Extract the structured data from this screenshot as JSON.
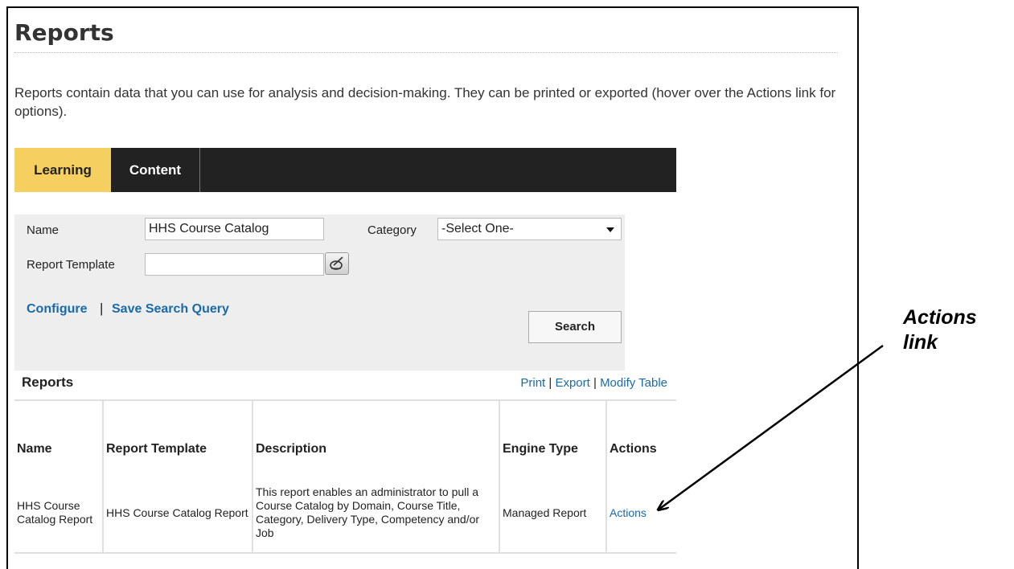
{
  "page": {
    "title": "Reports",
    "intro": "Reports contain data that you can use for analysis and decision-making. They can be printed or exported (hover over the Actions link for options)."
  },
  "tabs": [
    {
      "label": "Learning",
      "active": true
    },
    {
      "label": "Content",
      "active": false
    }
  ],
  "search": {
    "name_label": "Name",
    "name_value": "HHS Course Catalog",
    "category_label": "Category",
    "category_value": "-Select One-",
    "template_label": "Report Template",
    "template_value": "",
    "configure_link": "Configure",
    "separator": "|",
    "save_query_link": "Save Search Query",
    "search_button": "Search",
    "picker_icon": "picker-icon"
  },
  "reports": {
    "heading": "Reports",
    "print_link": "Print",
    "export_link": "Export",
    "modify_link": "Modify Table",
    "separator": "|",
    "columns": [
      "Name",
      "Report Template",
      "Description",
      "Engine Type",
      "Actions"
    ],
    "rows": [
      {
        "name": "HHS Course Catalog Report",
        "template": "HHS Course Catalog Report",
        "description": "This report enables an administrator to pull a Course Catalog by Domain, Course Title, Category, Delivery Type, Competency and/or Job",
        "engine": "Managed Report",
        "actions": "Actions"
      }
    ]
  },
  "annotation": {
    "line1": "Actions",
    "line2": "link"
  },
  "colors": {
    "active_tab": "#f5cf5f",
    "tabbar": "#222222",
    "link": "#1a6aa8",
    "panel": "#eeeeee"
  }
}
